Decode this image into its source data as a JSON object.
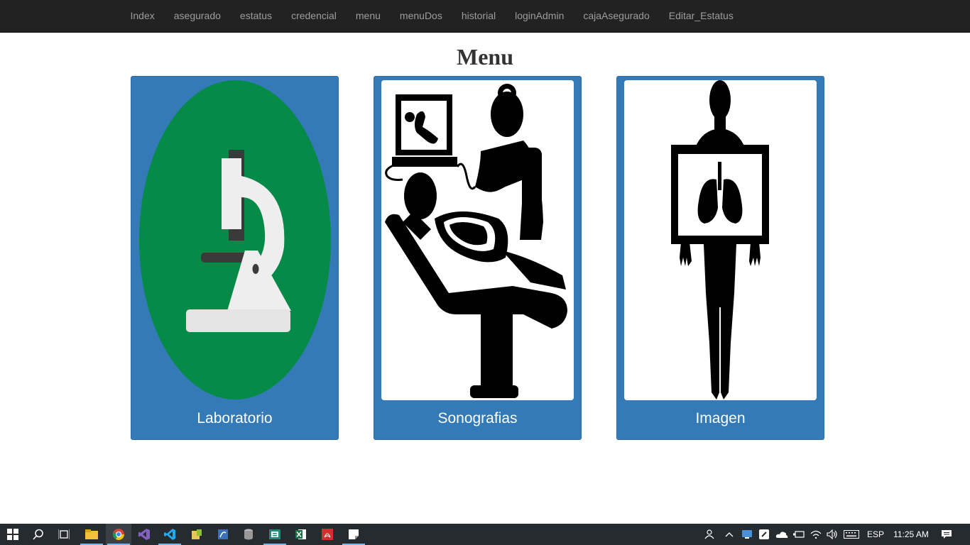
{
  "nav": {
    "links": [
      "Index",
      "asegurado",
      "estatus",
      "credencial",
      "menu",
      "menuDos",
      "historial",
      "loginAdmin",
      "cajaAsegurado",
      "Editar_Estatus"
    ]
  },
  "page": {
    "title": "Menu"
  },
  "cards": [
    {
      "label": "Laboratorio",
      "icon": "microscope-icon"
    },
    {
      "label": "Sonografias",
      "icon": "ultrasound-icon"
    },
    {
      "label": "Imagen",
      "icon": "xray-icon"
    }
  ],
  "taskbar": {
    "language": "ESP",
    "time": "11:25 AM"
  },
  "colors": {
    "navbar": "#222222",
    "nav_text": "#9d9d9d",
    "card_bg": "#337ab7",
    "lab_green": "#068a48",
    "taskbar": "#262b30"
  }
}
